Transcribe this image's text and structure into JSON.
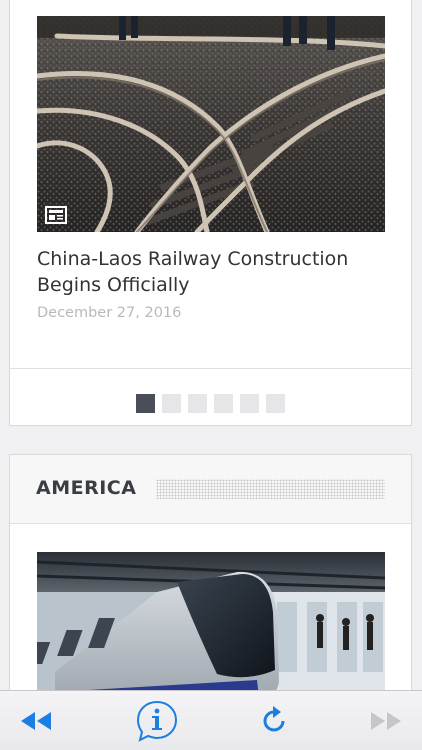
{
  "slider": {
    "title": "China-Laos Railway Construction Begins Officially",
    "date": "December 27, 2016",
    "badge_icon": "news-icon",
    "image_subject": "railway-tracks-junction",
    "pager": {
      "total": 6,
      "active": 1
    }
  },
  "section": {
    "title": "AMERICA",
    "image_subject": "skytrain-at-station"
  },
  "toolbar": {
    "back_icon": "rewind-icon",
    "info_icon": "info-icon",
    "reload_icon": "reload-icon",
    "forward_icon": "fast-forward-icon"
  },
  "colors": {
    "accent": "#1a7fe0",
    "disabled": "#c6c6ca",
    "pager_active": "#4a4e58",
    "pager_inactive": "#e6e6e8",
    "title_text": "#333333",
    "date_text": "#b9b9bd"
  }
}
